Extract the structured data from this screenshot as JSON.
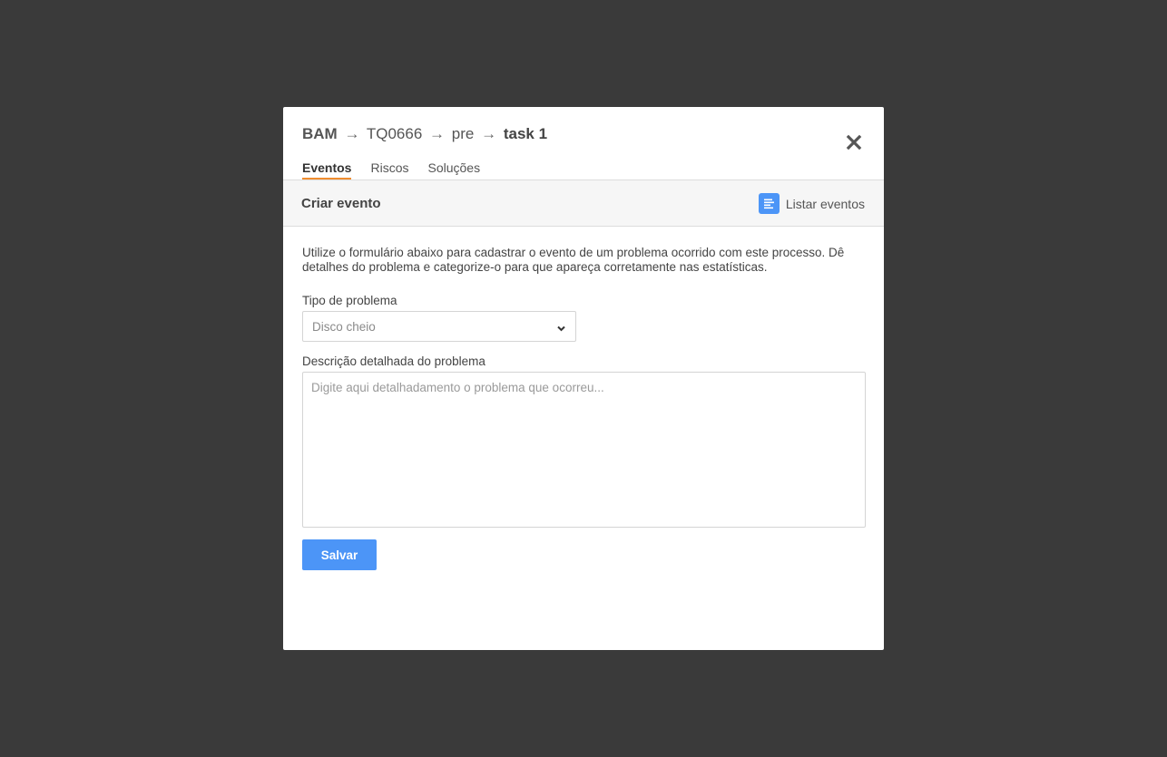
{
  "modal": {
    "breadcrumb": {
      "parts": [
        "BAM",
        "TQ0666",
        "pre",
        "task 1"
      ],
      "separator": "→"
    },
    "close_icon": "close-icon",
    "tabs": [
      {
        "label": "Eventos",
        "active": true
      },
      {
        "label": "Riscos",
        "active": false
      },
      {
        "label": "Soluções",
        "active": false
      }
    ]
  },
  "subheader": {
    "title": "Criar evento",
    "list_link_label": "Listar eventos",
    "list_icon": "list-icon"
  },
  "form": {
    "intro": "Utilize o formulário abaixo para cadastrar o evento de um problema ocorrido com este processo. Dê detalhes do problema e categorize-o para que apareça corretamente nas estatísticas.",
    "type_label": "Tipo de problema",
    "type_value": "Disco cheio",
    "description_label": "Descrição detalhada do problema",
    "description_placeholder": "Digite aqui detalhadamento o problema que ocorreu...",
    "save_label": "Salvar"
  },
  "colors": {
    "backdrop": "#3a3a3a",
    "accent_blue": "#4c95f7",
    "tab_underline": "#f08c2e"
  }
}
